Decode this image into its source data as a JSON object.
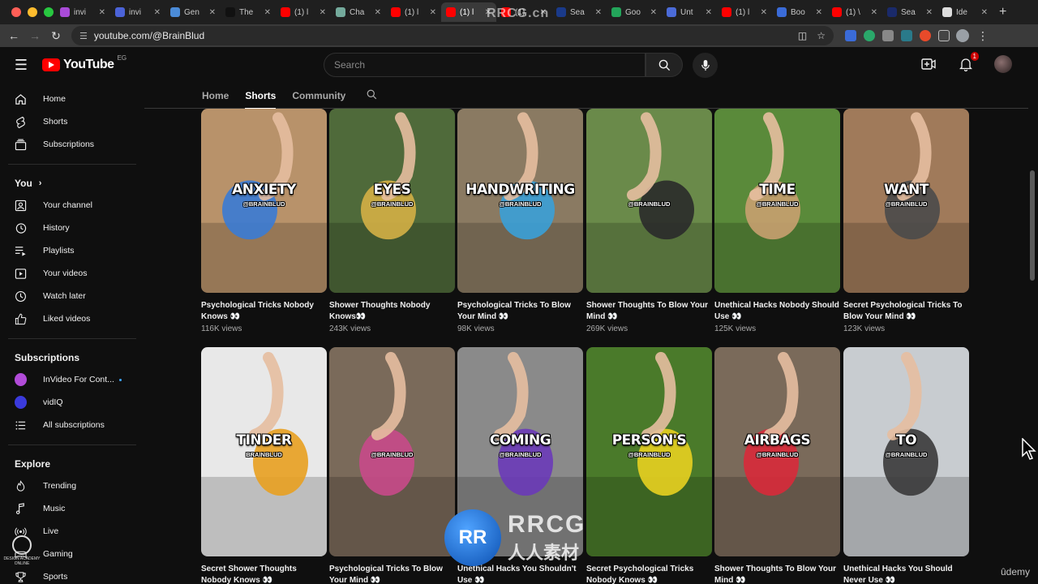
{
  "browser": {
    "tabs": [
      {
        "label": "invi",
        "color": "#a94bd8"
      },
      {
        "label": "invi",
        "color": "#4b63d8"
      },
      {
        "label": "Gen",
        "color": "#4b8bd8"
      },
      {
        "label": "The",
        "color": "#111111"
      },
      {
        "label": "(1) l",
        "color": "#ff0000"
      },
      {
        "label": "Cha",
        "color": "#74aa9c"
      },
      {
        "label": "(1) l",
        "color": "#ff0000"
      },
      {
        "label": "(1) l",
        "color": "#ff0000",
        "active": true
      },
      {
        "label": "(1)",
        "color": "#ff0000"
      },
      {
        "label": "Sea",
        "color": "#1a3a8a"
      },
      {
        "label": "Goo",
        "color": "#23a55a"
      },
      {
        "label": "Unt",
        "color": "#4b6bd8"
      },
      {
        "label": "(1) l",
        "color": "#ff0000"
      },
      {
        "label": "Boo",
        "color": "#3a6bd8"
      },
      {
        "label": "(1) \\",
        "color": "#ff0000"
      },
      {
        "label": "Sea",
        "color": "#1a2a6a"
      },
      {
        "label": "Ide",
        "color": "#dddddd"
      }
    ],
    "url": "youtube.com/@BrainBlud"
  },
  "header": {
    "logo_text": "YouTube",
    "region": "EG",
    "search_placeholder": "Search",
    "notification_count": "1"
  },
  "sidebar": {
    "main": [
      {
        "label": "Home",
        "icon": "home-icon"
      },
      {
        "label": "Shorts",
        "icon": "shorts-icon"
      },
      {
        "label": "Subscriptions",
        "icon": "subscriptions-icon"
      }
    ],
    "you_heading": "You",
    "you": [
      {
        "label": "Your channel",
        "icon": "channel-icon"
      },
      {
        "label": "History",
        "icon": "history-icon"
      },
      {
        "label": "Playlists",
        "icon": "playlists-icon"
      },
      {
        "label": "Your videos",
        "icon": "video-icon"
      },
      {
        "label": "Watch later",
        "icon": "clock-icon"
      },
      {
        "label": "Liked videos",
        "icon": "thumbs-up-icon"
      }
    ],
    "subscriptions_heading": "Subscriptions",
    "subscriptions": [
      {
        "label": "InVideo For Cont...",
        "color": "#b14bd8",
        "live": true
      },
      {
        "label": "vidIQ",
        "color": "#3a3adc",
        "live": false
      },
      {
        "label": "All subscriptions",
        "icon": "list-icon"
      }
    ],
    "explore_heading": "Explore",
    "explore": [
      {
        "label": "Trending",
        "icon": "fire-icon"
      },
      {
        "label": "Music",
        "icon": "music-icon"
      },
      {
        "label": "Live",
        "icon": "live-icon"
      },
      {
        "label": "Gaming",
        "icon": "gaming-icon"
      },
      {
        "label": "Sports",
        "icon": "trophy-icon"
      }
    ]
  },
  "channel_tabs": [
    "Home",
    "Shorts",
    "Community"
  ],
  "active_tab": "Shorts",
  "shorts_row1": [
    {
      "word": "ANXIETY",
      "handle": "@BRAINBLUD",
      "title": "Psychological Tricks Nobody Knows 👀",
      "views": "116K views",
      "bg": "#b8926a",
      "accent": "#3a7bd5"
    },
    {
      "word": "EYES",
      "handle": "@BRAINBLUD",
      "title": "Shower Thoughts Nobody Knows👀",
      "views": "243K views",
      "bg": "#4f6a3a",
      "accent": "#d4b046"
    },
    {
      "word": "HANDWRITING",
      "handle": "@BRAINBLUD",
      "title": "Psychological Tricks To Blow Your Mind 👀",
      "views": "98K views",
      "bg": "#8a7a62",
      "accent": "#3aa0d8"
    },
    {
      "word": "",
      "handle": "@BRAINBLUD",
      "title": "Shower Thoughts To Blow Your Mind 👀",
      "views": "269K views",
      "bg": "#6a8a4a",
      "accent": "#2a2a2a"
    },
    {
      "word": "TIME",
      "handle": "@BRAINBLUD",
      "title": "Unethical Hacks Nobody Should Use 👀",
      "views": "125K views",
      "bg": "#5a8a3a",
      "accent": "#c8a070"
    },
    {
      "word": "WANT",
      "handle": "@BRAINBLUD",
      "title": "Secret Psychological Tricks To Blow Your Mind 👀",
      "views": "123K views",
      "bg": "#a07a5a",
      "accent": "#4a4a4a"
    }
  ],
  "shorts_row2": [
    {
      "word": "TINDER",
      "handle": "BRAINBLUD",
      "title": "Secret Shower Thoughts Nobody Knows 👀",
      "views": "",
      "bg": "#e8e8e8",
      "accent": "#e8a020"
    },
    {
      "word": "",
      "handle": "@BRAINBLUD",
      "title": "Psychological Tricks To Blow Your Mind 👀",
      "views": "",
      "bg": "#7a6a5a",
      "accent": "#c84a8a"
    },
    {
      "word": "COMING",
      "handle": "@BRAINBLUD",
      "title": "Unethical Hacks You Shouldn't Use 👀",
      "views": "",
      "bg": "#8a8a8a",
      "accent": "#6a3ab8"
    },
    {
      "word": "PERSON'S",
      "handle": "@BRAINBLUD",
      "title": "Secret Psychological Tricks Nobody Knows 👀",
      "views": "",
      "bg": "#4a7a2a",
      "accent": "#e8d020"
    },
    {
      "word": "AIRBAGS",
      "handle": "@BRAINBLUD",
      "title": "Shower Thoughts To Blow Your Mind 👀",
      "views": "",
      "bg": "#7a6a5a",
      "accent": "#d82a3a"
    },
    {
      "word": "TO",
      "handle": "@BRAINBLUD",
      "title": "Unethical Hacks You Should Never Use 👀",
      "views": "",
      "bg": "#c8ccd0",
      "accent": "#3a3a3a"
    }
  ],
  "watermarks": {
    "top": "RRCG.cn",
    "big_logo": "RR",
    "big_text1": "RRCG",
    "big_text2": "人人素材",
    "udemy": "ûdemy",
    "badge": "DESIGN ACADEMY ONLINE"
  }
}
